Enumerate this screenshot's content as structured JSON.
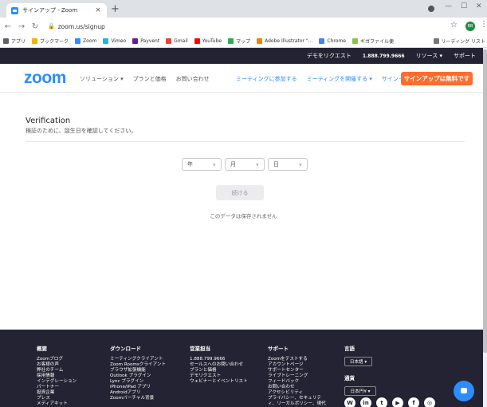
{
  "browser": {
    "tab_title": "サインアップ - Zoom",
    "tab_close": "×",
    "new_tab": "+",
    "url": "zoom.us/signup",
    "avatar_text": "BB",
    "bookmarks": [
      {
        "label": "アプリ",
        "color": "#5f6368"
      },
      {
        "label": "ブックマーク",
        "color": "#f4b400"
      },
      {
        "label": "Zoom",
        "color": "#2d8cff"
      },
      {
        "label": "Vimeo",
        "color": "#1ab7ea"
      },
      {
        "label": "Payvent",
        "color": "#6a1b9a"
      },
      {
        "label": "Gmail",
        "color": "#ea4335"
      },
      {
        "label": "YouTube",
        "color": "#ff0000"
      },
      {
        "label": "マップ",
        "color": "#34a853"
      },
      {
        "label": "Adobe Illustrator \"...",
        "color": "#ff7c00"
      },
      {
        "label": "Chrome",
        "color": "#4285f4"
      },
      {
        "label": "ギガファイル便",
        "color": "#8bc34a"
      }
    ],
    "reading_list": "リーディング リスト"
  },
  "utility_bar": {
    "demo": "デモをリクエスト",
    "phone": "1.888.799.9666",
    "resources": "リソース ▾",
    "support": "サポート"
  },
  "nav": {
    "logo": "zoom",
    "solutions": "ソリューション ▾",
    "plans": "プランと価格",
    "contact": "お問い合わせ",
    "join": "ミーティングに参加する",
    "host": "ミーティングを開催する ▾",
    "signin": "サインイン",
    "signup": "サインアップは無料です"
  },
  "verification": {
    "title": "Verification",
    "subtitle": "検証のために、誕生日を確認してください。",
    "year_label": "年",
    "month_label": "月",
    "day_label": "日",
    "continue_label": "続ける",
    "note": "このデータは保存されません"
  },
  "footer": {
    "col1": {
      "title": "概要",
      "items": [
        "Zoomブログ",
        "お客様の声",
        "弊社のチーム",
        "採用情報",
        "インテグレーション",
        "パートナー",
        "投資企業",
        "プレス",
        "メディアキット"
      ]
    },
    "col2": {
      "title": "ダウンロード",
      "items": [
        "ミーティングクライアント",
        "Zoom Roomsクライアント",
        "ブラウザ拡張機能",
        "Outlook プラグイン",
        "Lync プラグイン",
        "iPhone/iPad アプリ",
        "Androidアプリ",
        "Zoomバーチャル背景"
      ]
    },
    "col3": {
      "title": "営業担当",
      "items": [
        "1.888.799.9666",
        "セールスへのお問い合わせ",
        "プランと価格",
        "デモリクエスト",
        "ウェビナーとイベントリスト"
      ]
    },
    "col4": {
      "title": "サポート",
      "items": [
        "Zoomをテストする",
        "アカウントページ",
        "サポートセンター",
        "ライブトレーニング",
        "フィードバック",
        "お問い合わせ",
        "アクセシビリティ",
        "プライバシー、セキュリテ",
        "ィ、リーガルポリシー、現代"
      ]
    },
    "col5": {
      "title": "言語",
      "language": "日本語 ▾",
      "currency_title": "通貨",
      "currency": "日本円¥ ▾"
    }
  }
}
